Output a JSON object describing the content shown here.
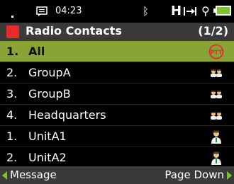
{
  "status": {
    "time": "04:23",
    "icons": [
      "message-icon",
      "bluetooth-icon",
      "hsdpa-icon",
      "signal-arrow-icon",
      "usb-icon",
      "battery-icon"
    ],
    "battery_color": "#7ec23a"
  },
  "title": {
    "label": "Radio Contacts",
    "page": "(1/2)",
    "accent": "#e42c2c"
  },
  "list": {
    "selected_color": "#8aa336",
    "items": [
      {
        "num": "1.",
        "name": "All",
        "icon": "ptt-icon"
      },
      {
        "num": "2.",
        "name": "GroupA",
        "icon": "group-icon"
      },
      {
        "num": "3.",
        "name": "GroupB",
        "icon": "group-icon"
      },
      {
        "num": "4.",
        "name": "Headquarters",
        "icon": "group-icon"
      },
      {
        "num": "1.",
        "name": "UnitA1",
        "icon": "user-icon"
      },
      {
        "num": "2.",
        "name": "UnitA2",
        "icon": "user-icon"
      }
    ]
  },
  "softkeys": {
    "left": "Message",
    "right": "Page Down"
  }
}
